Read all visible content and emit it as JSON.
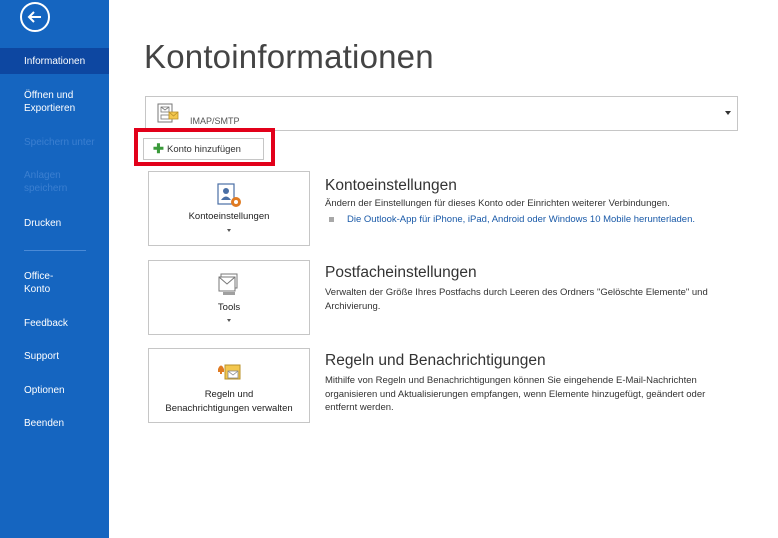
{
  "sidebar": {
    "items": [
      {
        "label": "Informationen"
      },
      {
        "label": "Öffnen und Exportieren"
      },
      {
        "label": "Speichern unter"
      },
      {
        "label": "Anlagen speichern"
      },
      {
        "label": "Drucken"
      },
      {
        "label": "Office-Konto"
      },
      {
        "label": "Feedback"
      },
      {
        "label": "Support"
      },
      {
        "label": "Optionen"
      },
      {
        "label": "Beenden"
      }
    ]
  },
  "main": {
    "title": "Kontoinformationen",
    "account": {
      "type": "IMAP/SMTP"
    },
    "add_account_label": "Konto hinzufügen",
    "sections": [
      {
        "tile_label": "Kontoeinstellungen",
        "title": "Kontoeinstellungen",
        "desc": "Ändern der Einstellungen für dieses Konto oder Einrichten weiterer Verbindungen.",
        "link": "Die Outlook-App für iPhone, iPad, Android oder Windows 10 Mobile herunterladen."
      },
      {
        "tile_label": "Tools",
        "title": "Postfacheinstellungen",
        "desc": "Verwalten der Größe Ihres Postfachs durch Leeren des Ordners \"Gelöschte Elemente\" und Archivierung."
      },
      {
        "tile_label_line1": "Regeln und",
        "tile_label_line2": "Benachrichtigungen verwalten",
        "title": "Regeln und Benachrichtigungen",
        "desc": "Mithilfe von Regeln und Benachrichtigungen können Sie eingehende E-Mail-Nachrichten organisieren und Aktualisierungen empfangen, wenn Elemente hinzugefügt, geändert oder entfernt werden."
      }
    ]
  },
  "colors": {
    "sidebar": "#1565c0",
    "sidebar_active": "#0d47a1",
    "highlight": "#e2001a",
    "link": "#1a5aa8"
  }
}
